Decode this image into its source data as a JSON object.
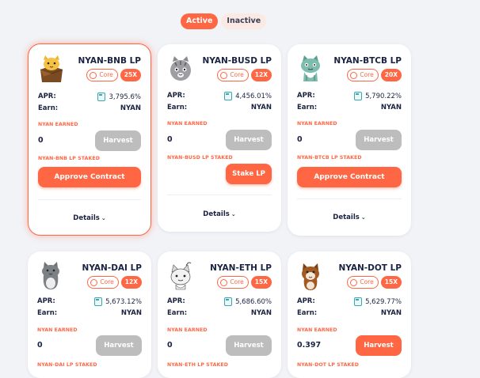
{
  "filter": {
    "active_label": "Active",
    "inactive_label": "Inactive"
  },
  "common": {
    "apr_label": "APR:",
    "earn_label": "Earn:",
    "core_label": "Core",
    "earned_label": "NYAN EARNED",
    "harvest_label": "Harvest",
    "details_label": "Details"
  },
  "farms": [
    {
      "name": "NYAN-BNB LP",
      "multiplier": "25X",
      "apr": "3,795.6%",
      "earn": "NYAN",
      "earned": "0",
      "staked_label": "NYAN-BNB LP STAKED",
      "action_label": "Approve Contract",
      "harvest_enabled": false,
      "icon": "cat-in-box-icon"
    },
    {
      "name": "NYAN-BUSD LP",
      "multiplier": "12X",
      "apr": "4,456.01%",
      "earn": "NYAN",
      "earned": "0",
      "staked_label": "NYAN-BUSD LP STAKED",
      "action_label": "Stake LP",
      "harvest_enabled": false,
      "icon": "grey-cat-icon"
    },
    {
      "name": "NYAN-BTCB LP",
      "multiplier": "20X",
      "apr": "5,790.22%",
      "earn": "NYAN",
      "earned": "0",
      "staked_label": "NYAN-BTCB LP STAKED",
      "action_label": "Approve Contract",
      "harvest_enabled": false,
      "icon": "teal-cat-icon"
    },
    {
      "name": "NYAN-DAI LP",
      "multiplier": "12X",
      "apr": "5,673.12%",
      "earn": "NYAN",
      "earned": "0",
      "staked_label": "NYAN-DAI LP STAKED",
      "harvest_enabled": false,
      "icon": "grey-sitting-cat-icon"
    },
    {
      "name": "NYAN-ETH LP",
      "multiplier": "15X",
      "apr": "5,686.60%",
      "earn": "NYAN",
      "earned": "0",
      "staked_label": "NYAN-ETH LP STAKED",
      "harvest_enabled": false,
      "icon": "white-cat-icon"
    },
    {
      "name": "NYAN-DOT LP",
      "multiplier": "15X",
      "apr": "5,629.77%",
      "earn": "NYAN",
      "earned": "0.397",
      "staked_label": "NYAN-DOT LP STAKED",
      "harvest_enabled": true,
      "icon": "brown-cat-icon"
    }
  ],
  "colors": {
    "accent": "#ff6644",
    "text": "#1b2340",
    "disabled": "#bdbdbd",
    "background": "#f2f3f7"
  }
}
